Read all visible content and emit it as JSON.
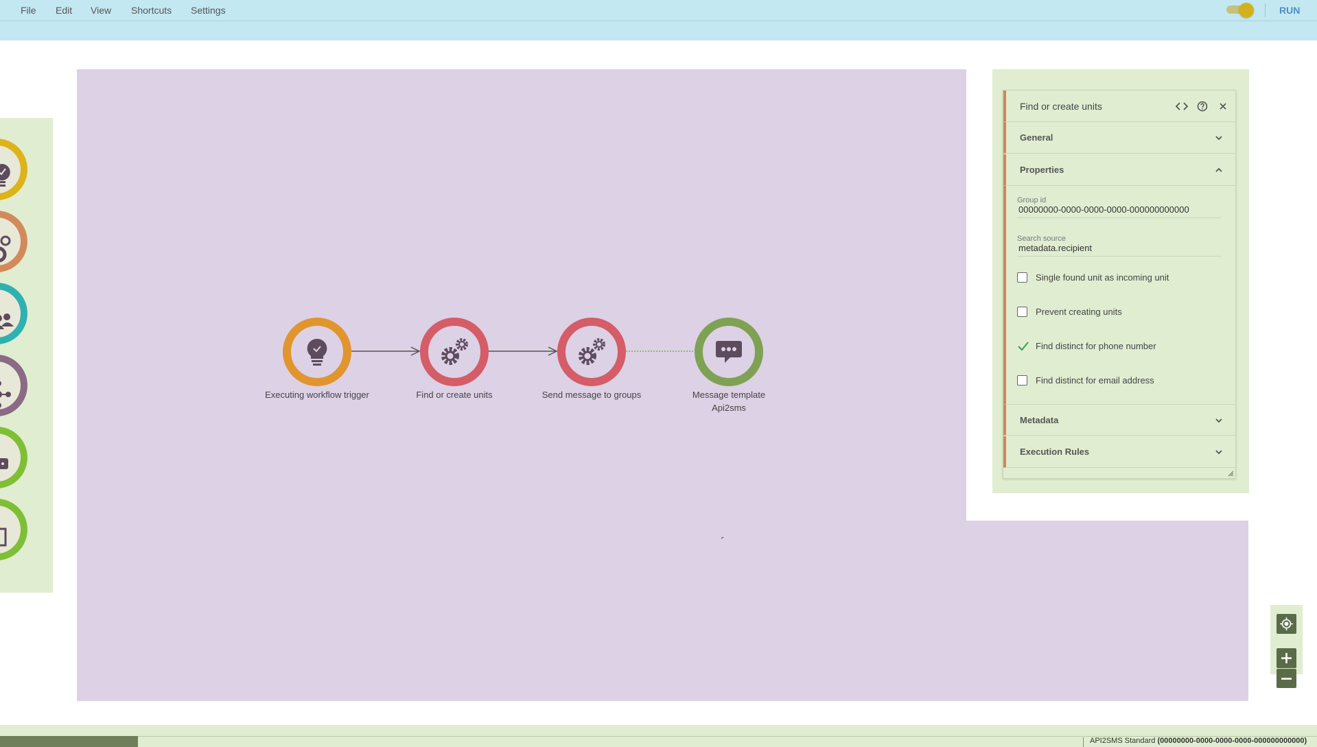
{
  "menu": {
    "file": "File",
    "edit": "Edit",
    "view": "View",
    "shortcuts": "Shortcuts",
    "settings": "Settings"
  },
  "toolbar": {
    "toggle_on": true,
    "run_label": "RUN"
  },
  "palette": {
    "items": [
      {
        "icon": "lightbulb-icon",
        "color": "#ddb31a"
      },
      {
        "icon": "gear-icon",
        "color": "#d38a5b"
      },
      {
        "icon": "users-icon",
        "color": "#2eb1b0"
      },
      {
        "icon": "network-icon",
        "color": "#8a6a85"
      },
      {
        "icon": "chat-icon",
        "color": "#7fbf35"
      },
      {
        "icon": "document-icon",
        "color": "#7fbf35"
      }
    ]
  },
  "workflow": {
    "nodes": [
      {
        "label": "Executing workflow trigger",
        "icon": "lightbulb-icon",
        "color": "#e0952e"
      },
      {
        "label": "Find or create units",
        "icon": "gears-icon",
        "color": "#d45d67"
      },
      {
        "label": "Send message to groups",
        "icon": "gears-icon",
        "color": "#d45d67"
      },
      {
        "label": "Message template",
        "label2": "Api2sms",
        "icon": "chat-icon",
        "color": "#7fa154"
      }
    ]
  },
  "properties": {
    "title": "Find or create units",
    "sections": {
      "general": "General",
      "properties": "Properties",
      "metadata": "Metadata",
      "execution_rules": "Execution Rules"
    },
    "fields": {
      "group_id_label": "Group id",
      "group_id_value": "00000000-0000-0000-0000-000000000000",
      "search_source_label": "Search source",
      "search_source_value": "metadata.recipient"
    },
    "checkboxes": [
      {
        "label": "Single found unit as incoming unit",
        "checked": false
      },
      {
        "label": "Prevent creating units",
        "checked": false
      },
      {
        "label": "Find distinct for phone number",
        "checked": true
      },
      {
        "label": "Find distinct for email address",
        "checked": false
      }
    ]
  },
  "status": {
    "plan": "API2SMS Standard",
    "id": "(00000000-0000-0000-0000-000000000000)"
  },
  "colors": {
    "menubar": "#c3e8f2",
    "canvas": "#ddd1e5",
    "panel": "#e0edd1",
    "accent_run": "#4e8fc2",
    "section_accent": "#d2845a",
    "check": "#3a9a5a"
  }
}
